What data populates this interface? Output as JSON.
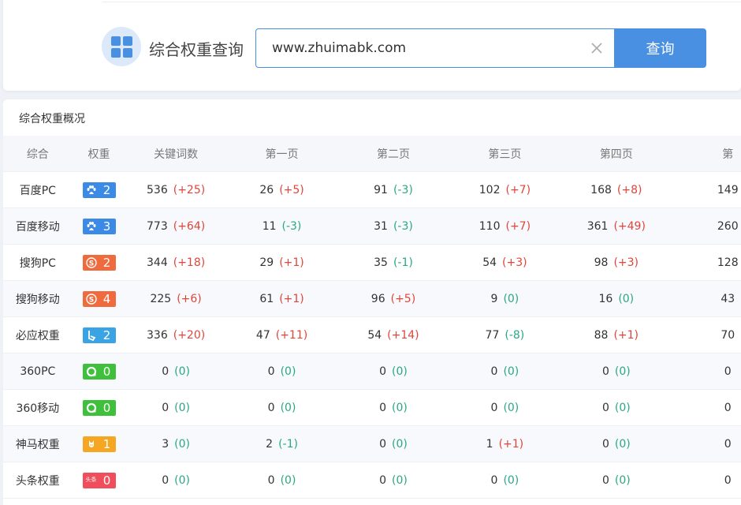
{
  "tool": {
    "title": "综合权重查询",
    "icon": "grid-icon"
  },
  "search": {
    "value": "www.zhuimabk.com",
    "button_label": "查询"
  },
  "overview": {
    "title": "综合权重概况",
    "columns": [
      "综合",
      "权重",
      "关键词数",
      "第一页",
      "第二页",
      "第三页",
      "第四页",
      "第"
    ],
    "rows": [
      {
        "name": "百度PC",
        "engine": "baidu",
        "rank": "2",
        "icon": "baidu-paw-icon",
        "color": "#3b8ae6",
        "cells": [
          [
            "536",
            "(+25)",
            "up"
          ],
          [
            "26",
            "(+5)",
            "up"
          ],
          [
            "91",
            "(-3)",
            "down"
          ],
          [
            "102",
            "(+7)",
            "up"
          ],
          [
            "168",
            "(+8)",
            "up"
          ],
          [
            "149",
            "",
            ""
          ]
        ]
      },
      {
        "name": "百度移动",
        "engine": "baidu",
        "rank": "3",
        "icon": "baidu-paw-icon",
        "color": "#3b8ae6",
        "cells": [
          [
            "773",
            "(+64)",
            "up"
          ],
          [
            "11",
            "(-3)",
            "down"
          ],
          [
            "31",
            "(-3)",
            "down"
          ],
          [
            "110",
            "(+7)",
            "up"
          ],
          [
            "361",
            "(+49)",
            "up"
          ],
          [
            "260",
            "",
            ""
          ]
        ]
      },
      {
        "name": "搜狗PC",
        "engine": "sogou",
        "rank": "2",
        "icon": "sogou-s-icon",
        "color": "#ef6a3c",
        "cells": [
          [
            "344",
            "(+18)",
            "up"
          ],
          [
            "29",
            "(+1)",
            "up"
          ],
          [
            "35",
            "(-1)",
            "down"
          ],
          [
            "54",
            "(+3)",
            "up"
          ],
          [
            "98",
            "(+3)",
            "up"
          ],
          [
            "128",
            "",
            ""
          ]
        ]
      },
      {
        "name": "搜狗移动",
        "engine": "sogou",
        "rank": "4",
        "icon": "sogou-s-icon",
        "color": "#ef6a3c",
        "cells": [
          [
            "225",
            "(+6)",
            "up"
          ],
          [
            "61",
            "(+1)",
            "up"
          ],
          [
            "96",
            "(+5)",
            "up"
          ],
          [
            "9",
            "(0)",
            "zero"
          ],
          [
            "16",
            "(0)",
            "zero"
          ],
          [
            "43",
            "",
            ""
          ]
        ]
      },
      {
        "name": "必应权重",
        "engine": "bing",
        "rank": "2",
        "icon": "bing-b-icon",
        "color": "#3aa3e3",
        "cells": [
          [
            "336",
            "(+20)",
            "up"
          ],
          [
            "47",
            "(+11)",
            "up"
          ],
          [
            "54",
            "(+14)",
            "up"
          ],
          [
            "77",
            "(-8)",
            "down"
          ],
          [
            "88",
            "(+1)",
            "up"
          ],
          [
            "70",
            "",
            ""
          ]
        ]
      },
      {
        "name": "360PC",
        "engine": "360",
        "rank": "0",
        "icon": "360-ring-icon",
        "color": "#3fc03c",
        "cells": [
          [
            "0",
            "(0)",
            "zero"
          ],
          [
            "0",
            "(0)",
            "zero"
          ],
          [
            "0",
            "(0)",
            "zero"
          ],
          [
            "0",
            "(0)",
            "zero"
          ],
          [
            "0",
            "(0)",
            "zero"
          ],
          [
            "0",
            "",
            ""
          ]
        ]
      },
      {
        "name": "360移动",
        "engine": "360",
        "rank": "0",
        "icon": "360-ring-icon",
        "color": "#3fc03c",
        "cells": [
          [
            "0",
            "(0)",
            "zero"
          ],
          [
            "0",
            "(0)",
            "zero"
          ],
          [
            "0",
            "(0)",
            "zero"
          ],
          [
            "0",
            "(0)",
            "zero"
          ],
          [
            "0",
            "(0)",
            "zero"
          ],
          [
            "0",
            "",
            ""
          ]
        ]
      },
      {
        "name": "神马权重",
        "engine": "shenma",
        "rank": "1",
        "icon": "shenma-horse-icon",
        "color": "#f5a623",
        "cells": [
          [
            "3",
            "(0)",
            "zero"
          ],
          [
            "2",
            "(-1)",
            "down"
          ],
          [
            "0",
            "(0)",
            "zero"
          ],
          [
            "1",
            "(+1)",
            "up"
          ],
          [
            "0",
            "(0)",
            "zero"
          ],
          [
            "0",
            "",
            ""
          ]
        ]
      },
      {
        "name": "头条权重",
        "engine": "toutiao",
        "rank": "0",
        "icon": "toutiao-icon",
        "color": "#f04e5a",
        "icon_text": "头条",
        "cells": [
          [
            "0",
            "(0)",
            "zero"
          ],
          [
            "0",
            "(0)",
            "zero"
          ],
          [
            "0",
            "(0)",
            "zero"
          ],
          [
            "0",
            "(0)",
            "zero"
          ],
          [
            "0",
            "(0)",
            "zero"
          ],
          [
            "0",
            "",
            ""
          ]
        ]
      }
    ]
  }
}
